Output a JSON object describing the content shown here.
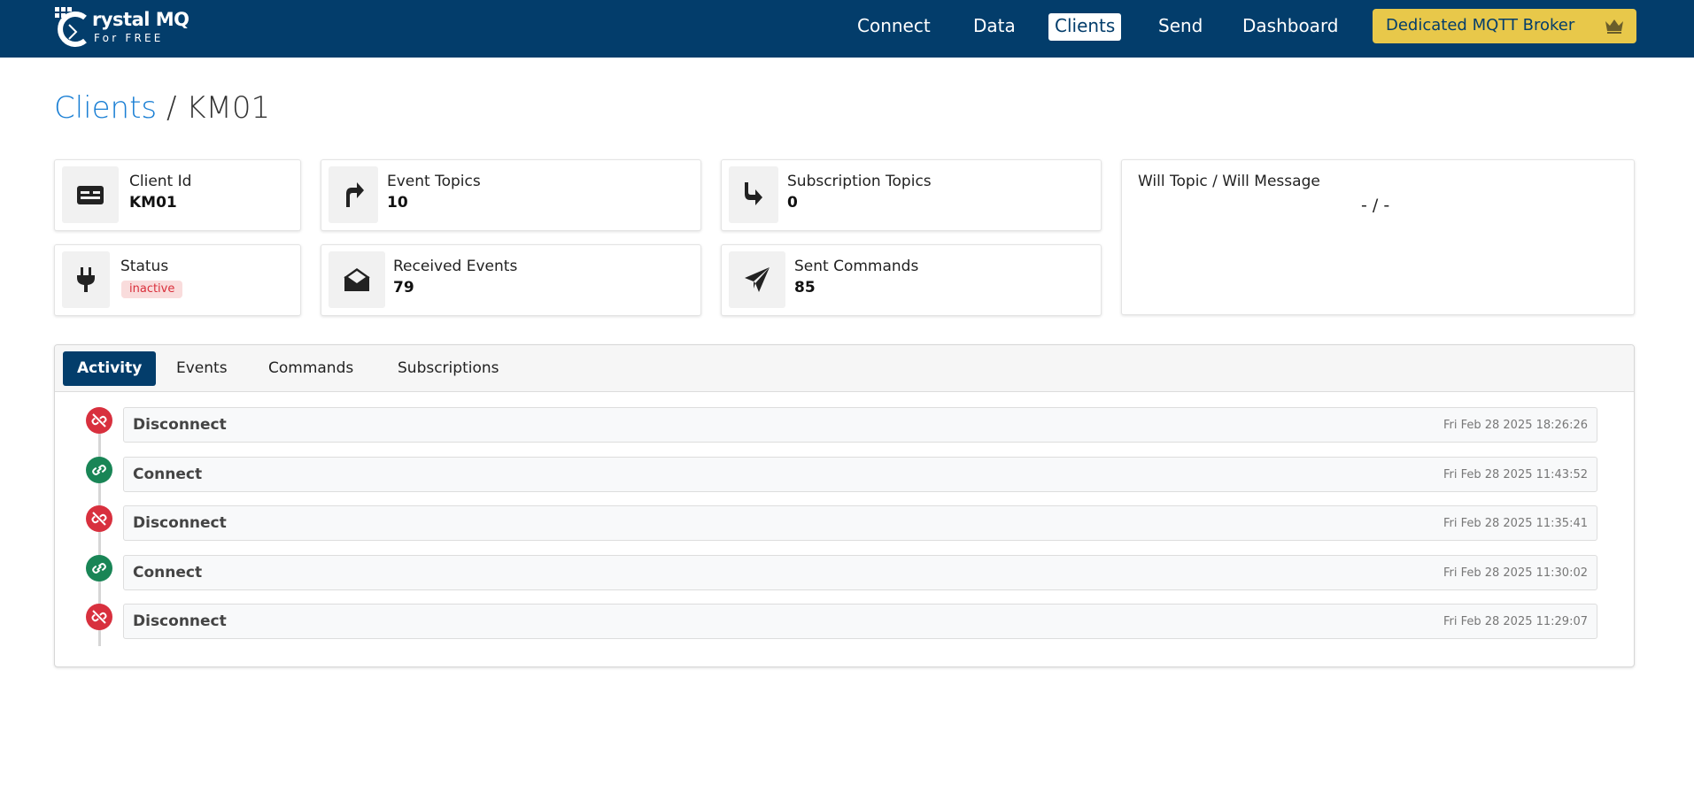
{
  "brand": {
    "name": "rystal MQ",
    "tagline": "For FREE"
  },
  "nav": {
    "items": [
      {
        "label": "Connect"
      },
      {
        "label": "Data"
      },
      {
        "label": "Clients",
        "active": true
      },
      {
        "label": "Send"
      },
      {
        "label": "Dashboard"
      }
    ],
    "premium_label": "Dedicated MQTT Broker"
  },
  "title": {
    "crumb": "Clients",
    "separator": "/",
    "current": "KM01"
  },
  "stats": {
    "client_id": {
      "label": "Client Id",
      "value": "KM01",
      "icon": "id-card-icon"
    },
    "event_topics": {
      "label": "Event Topics",
      "value": "10",
      "icon": "arrow-turn-up-icon"
    },
    "subscription_topics": {
      "label": "Subscription Topics",
      "value": "0",
      "icon": "arrow-turn-down-icon"
    },
    "status": {
      "label": "Status",
      "value": "inactive",
      "icon": "plug-icon"
    },
    "received_events": {
      "label": "Received Events",
      "value": "79",
      "icon": "envelope-open-icon"
    },
    "sent_commands": {
      "label": "Sent Commands",
      "value": "85",
      "icon": "paper-plane-icon"
    },
    "will": {
      "label": "Will Topic / Will Message",
      "value": "- / -"
    }
  },
  "tabs": [
    {
      "label": "Activity",
      "active": true
    },
    {
      "label": "Events"
    },
    {
      "label": "Commands"
    },
    {
      "label": "Subscriptions"
    }
  ],
  "activity": [
    {
      "event": "Disconnect",
      "time": "Fri Feb 28 2025 18:26:26"
    },
    {
      "event": "Connect",
      "time": "Fri Feb 28 2025 11:43:52"
    },
    {
      "event": "Disconnect",
      "time": "Fri Feb 28 2025 11:35:41"
    },
    {
      "event": "Connect",
      "time": "Fri Feb 28 2025 11:30:02"
    },
    {
      "event": "Disconnect",
      "time": "Fri Feb 28 2025 11:29:07"
    }
  ],
  "colors": {
    "navbar": "#033d6b",
    "premium": "#e8c84a",
    "link": "#1a7fd4",
    "disconnect": "#d8303e",
    "connect": "#198556",
    "inactive_badge_bg": "#f9dcdc",
    "inactive_badge_text": "#d92f3b"
  }
}
